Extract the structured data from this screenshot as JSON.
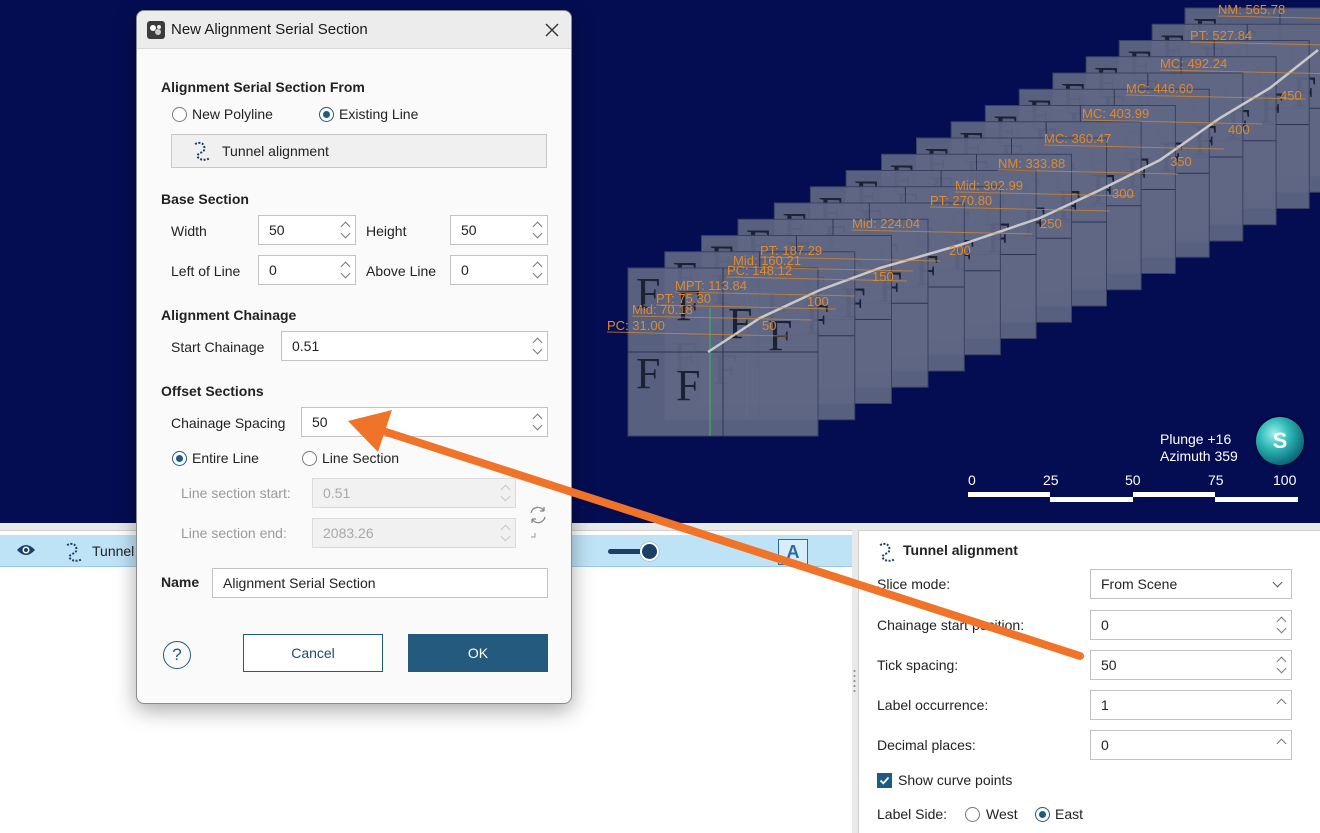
{
  "scene": {
    "orientation": {
      "plunge": "Plunge +16",
      "azimuth": "Azimuth 359"
    },
    "scale_bar": [
      "0",
      "25",
      "50",
      "75",
      "100"
    ],
    "chainage_labels": [
      "50",
      "100",
      "150",
      "200",
      "250",
      "300",
      "350",
      "400",
      "450"
    ],
    "curve_labels": [
      "PC: 31.00",
      "Mid: 70.18",
      "PT: 75.30",
      "MPT: 113.84",
      "PC: 148.12",
      "Mid: 160.21",
      "PT: 187.29",
      "Mid: 224.04",
      "PT: 270.80",
      "Mid: 302.99",
      "NM: 333.88",
      "MC: 360.47",
      "MC: 403.99",
      "MC: 446.60",
      "MC: 492.24",
      "PT: 527.84",
      "NM: 565.78"
    ],
    "glyph": "F",
    "colors": {
      "background": "#040d52",
      "label": "#e08a2a",
      "panel": "#5f6784",
      "alignment": "#c9c9c9",
      "arrow": "#f0732a"
    }
  },
  "dialog": {
    "title": "New Alignment Serial Section",
    "from_section": "Alignment Serial Section From",
    "new_polyline": "New Polyline",
    "existing_line": "Existing Line",
    "existing_line_value": "Tunnel alignment",
    "base_section": "Base Section",
    "width_label": "Width",
    "width_value": "50",
    "height_label": "Height",
    "height_value": "50",
    "left_label": "Left of Line",
    "left_value": "0",
    "above_label": "Above Line",
    "above_value": "0",
    "chainage_section": "Alignment Chainage",
    "start_chainage_label": "Start Chainage",
    "start_chainage_value": "0.51",
    "offset_section": "Offset Sections",
    "spacing_label": "Chainage Spacing",
    "spacing_value": "50",
    "entire_line": "Entire Line",
    "line_section": "Line Section",
    "section_start_label": "Line section start:",
    "section_start_value": "0.51",
    "section_end_label": "Line section end:",
    "section_end_value": "2083.26",
    "name_label": "Name",
    "name_value": "Alignment Serial Section",
    "cancel": "Cancel",
    "ok": "OK",
    "help": "?"
  },
  "tree": {
    "item_label": "Tunnel",
    "text_icon": "A"
  },
  "props": {
    "title": "Tunnel alignment",
    "slice_mode_label": "Slice mode:",
    "slice_mode_value": "From Scene",
    "chainage_start_label": "Chainage start position:",
    "chainage_start_value": "0",
    "tick_spacing_label": "Tick spacing:",
    "tick_spacing_value": "50",
    "label_occurrence_label": "Label occurrence:",
    "label_occurrence_value": "1",
    "decimal_places_label": "Decimal places:",
    "decimal_places_value": "0",
    "show_curve_points": "Show curve points",
    "label_side": "Label Side:",
    "west": "West",
    "east": "East"
  }
}
